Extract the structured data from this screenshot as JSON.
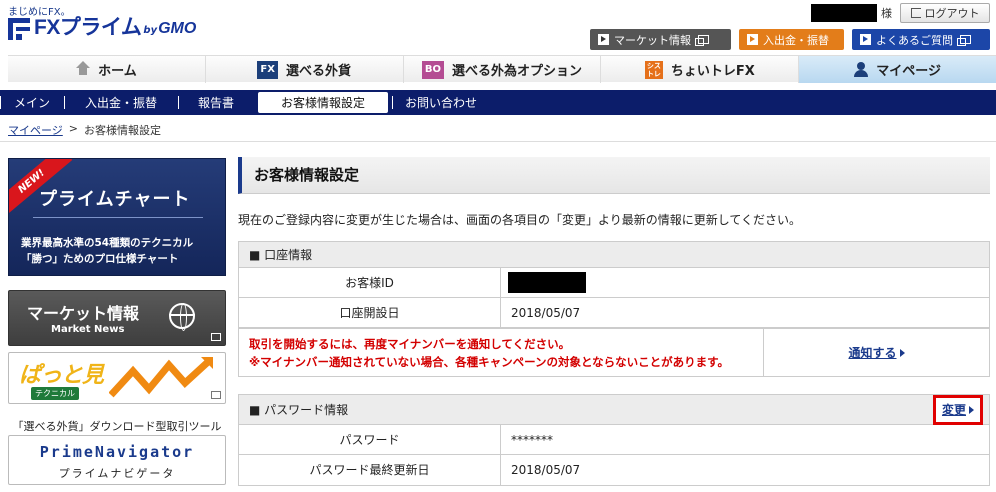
{
  "header": {
    "logo_tagline": "まじめにFX。",
    "logo_main": "FXプライム",
    "logo_by": "by",
    "logo_gmo": "GMO",
    "user_suffix": "様",
    "logout_label": "ログアウト",
    "top_buttons": [
      {
        "label": "マーケット情報"
      },
      {
        "label": "入出金・振替"
      },
      {
        "label": "よくあるご質問"
      }
    ]
  },
  "main_nav": [
    {
      "label": "ホーム"
    },
    {
      "label": "選べる外貨",
      "badge": "FX"
    },
    {
      "label": "選べる外為オプション",
      "badge": "BO"
    },
    {
      "label": "ちょいトレFX",
      "badge": "シストレ"
    },
    {
      "label": "マイページ"
    }
  ],
  "sub_nav": [
    {
      "label": "メイン"
    },
    {
      "label": "入出金・振替"
    },
    {
      "label": "報告書"
    },
    {
      "label": "お客様情報設定"
    },
    {
      "label": "お問い合わせ"
    }
  ],
  "breadcrumb": {
    "parent": "マイページ",
    "separator": ">",
    "current": "お客様情報設定"
  },
  "sidebar": {
    "chart_banner": {
      "ribbon": "NEW!",
      "title": "プライムチャート",
      "line1": "業界最高水準の54種類のテクニカル",
      "line2": "「勝つ」ためのプロ仕様チャート"
    },
    "market_banner": {
      "title": "マーケット情報",
      "subtitle": "Market News"
    },
    "technical_banner": {
      "title": "ぱっと見",
      "subtitle": "テクニカル"
    },
    "tool_caption": "「選べる外貨」ダウンロード型取引ツール",
    "prime_banner": {
      "title": "PrimeNavigator",
      "subtitle": "プライムナビゲータ"
    }
  },
  "content": {
    "title": "お客様情報設定",
    "intro": "現在のご登録内容に変更が生じた場合は、画面の各項目の「変更」より最新の情報に更新してください。",
    "account_section": {
      "heading": "■ 口座情報",
      "rows": [
        {
          "label": "お客様ID",
          "value": ""
        },
        {
          "label": "口座開設日",
          "value": "2018/05/07"
        }
      ],
      "warning_line1": "取引を開始するには、再度マイナンバーを通知してください。",
      "warning_line2": "※マイナンバー通知されていない場合、各種キャンペーンの対象とならないことがあります。",
      "notify_link": "通知する"
    },
    "password_section": {
      "heading": "■ パスワード情報",
      "change_link": "変更",
      "rows": [
        {
          "label": "パスワード",
          "value": "*******"
        },
        {
          "label": "パスワード最終更新日",
          "value": "2018/05/07"
        }
      ]
    }
  }
}
